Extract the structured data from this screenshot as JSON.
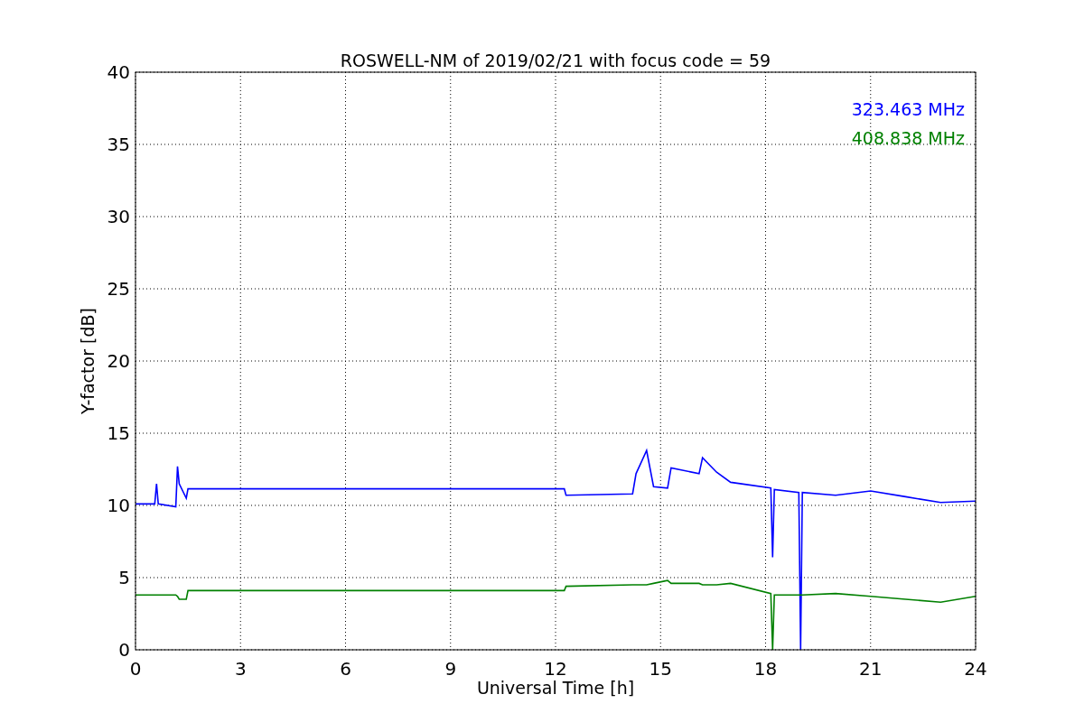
{
  "chart_data": {
    "type": "line",
    "grid": true,
    "title": "ROSWELL-NM of 2019/02/21 with focus code = 59",
    "xlabel": "Universal Time [h]",
    "ylabel": "Y-factor [dB]",
    "xlim": [
      0,
      24
    ],
    "ylim": [
      0,
      40
    ],
    "xticks": [
      0,
      3,
      6,
      9,
      12,
      15,
      18,
      21,
      24
    ],
    "yticks": [
      0,
      5,
      10,
      15,
      20,
      25,
      30,
      35,
      40
    ],
    "x": [
      0,
      0.55,
      0.6,
      0.65,
      1.15,
      1.2,
      1.25,
      1.45,
      1.5,
      12.25,
      12.3,
      14.2,
      14.3,
      14.6,
      14.8,
      15.2,
      15.3,
      16.1,
      16.2,
      16.6,
      17,
      18.15,
      18.2,
      18.25,
      18.95,
      19,
      19.05,
      20,
      21,
      22,
      23,
      24
    ],
    "series": [
      {
        "name": "323.463 MHz",
        "color": "#0000ff",
        "values": [
          10.1,
          10.1,
          11.5,
          10.1,
          9.9,
          12.7,
          11.5,
          10.5,
          11.15,
          11.15,
          10.7,
          10.8,
          12.2,
          13.8,
          11.3,
          11.2,
          12.6,
          12.2,
          13.3,
          12.3,
          11.6,
          11.2,
          6.4,
          11.1,
          10.9,
          0,
          10.9,
          10.7,
          11,
          10.6,
          10.2,
          10.3
        ]
      },
      {
        "name": "408.838 MHz",
        "color": "#008000",
        "values": [
          3.8,
          3.8,
          3.8,
          3.8,
          3.8,
          3.7,
          3.5,
          3.5,
          4.1,
          4.1,
          4.4,
          4.5,
          4.5,
          4.5,
          4.6,
          4.8,
          4.6,
          4.6,
          4.5,
          4.5,
          4.6,
          3.9,
          0,
          3.8,
          3.8,
          3.8,
          3.8,
          3.9,
          3.7,
          3.5,
          3.3,
          3.7
        ]
      }
    ]
  }
}
